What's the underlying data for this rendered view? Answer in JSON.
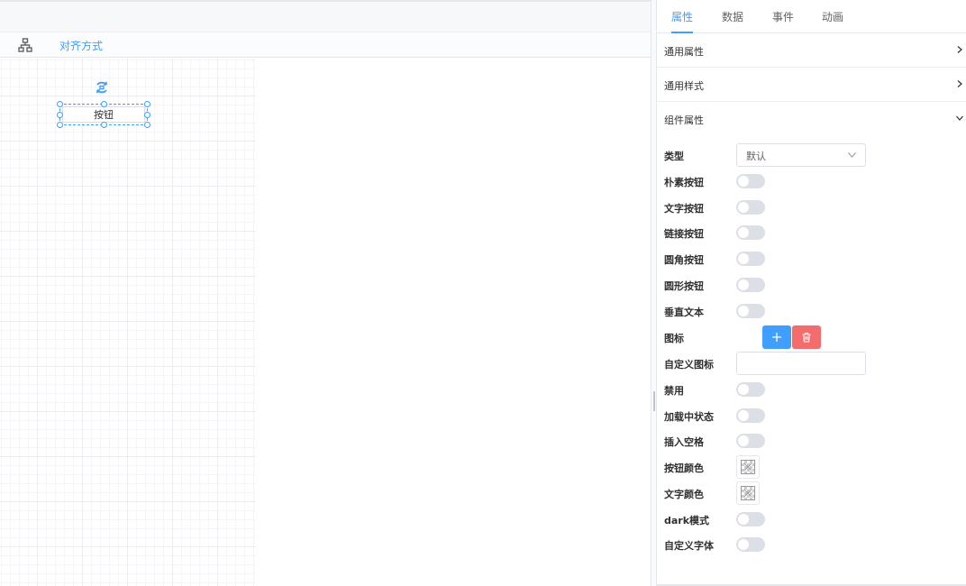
{
  "toolbar": {
    "align_label": "对齐方式"
  },
  "canvas": {
    "selected_button_label": "按钮"
  },
  "tabs": [
    {
      "label": "属性",
      "active": true
    },
    {
      "label": "数据",
      "active": false
    },
    {
      "label": "事件",
      "active": false
    },
    {
      "label": "动画",
      "active": false
    }
  ],
  "sections": {
    "common_props": "通用属性",
    "common_style": "通用样式",
    "component_props": "组件属性"
  },
  "fields": {
    "type": {
      "label": "类型",
      "value": "默认"
    },
    "plain": {
      "label": "朴素按钮",
      "on": false
    },
    "text": {
      "label": "文字按钮",
      "on": false
    },
    "link": {
      "label": "链接按钮",
      "on": false
    },
    "round": {
      "label": "圆角按钮",
      "on": false
    },
    "circle": {
      "label": "圆形按钮",
      "on": false
    },
    "vertical": {
      "label": "垂直文本",
      "on": false
    },
    "icon": {
      "label": "图标"
    },
    "custom_icon": {
      "label": "自定义图标",
      "value": "",
      "placeholder": ""
    },
    "disabled": {
      "label": "禁用",
      "on": false
    },
    "loading": {
      "label": "加载中状态",
      "on": false
    },
    "auto_insert_space": {
      "label": "插入空格",
      "on": false
    },
    "button_color": {
      "label": "按钮颜色",
      "value": ""
    },
    "text_color": {
      "label": "文字颜色",
      "value": ""
    },
    "dark": {
      "label": "dark模式",
      "on": false
    },
    "custom_font": {
      "label": "自定义字体",
      "on": false
    }
  },
  "colors": {
    "primary": "#409eff",
    "danger": "#f56c6c",
    "switch_off": "#dcdfe6"
  }
}
